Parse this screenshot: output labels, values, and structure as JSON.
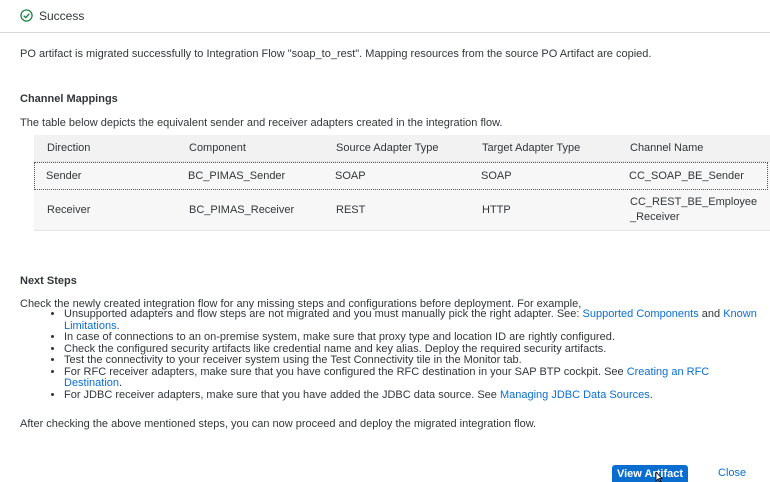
{
  "dialog": {
    "title": "Success",
    "message": "PO artifact is migrated successfully to Integration Flow \"soap_to_rest\". Mapping resources from the source PO Artifact are copied."
  },
  "channel_mappings": {
    "title": "Channel Mappings",
    "description": "The table below depicts the equivalent sender and receiver adapters created in the integration flow.",
    "columns": [
      "Direction",
      "Component",
      "Source Adapter Type",
      "Target Adapter Type",
      "Channel Name"
    ],
    "rows": [
      [
        "Sender",
        "BC_PIMAS_Sender",
        "SOAP",
        "SOAP",
        "CC_SOAP_BE_Sender"
      ],
      [
        "Receiver",
        "BC_PIMAS_Receiver",
        "REST",
        "HTTP",
        "CC_REST_BE_Employee_Receiver"
      ]
    ]
  },
  "next_steps": {
    "title": "Next Steps",
    "intro": "Check the newly created integration flow for any missing steps and configurations before deployment. For example,",
    "items": {
      "i1_text": "Unsupported adapters and flow steps are not migrated and you must manually pick the right adapter. See: ",
      "i1_link1": "Supported Components",
      "i1_and": " and ",
      "i1_link2": "Known Limitations",
      "i1_end": ".",
      "i2": "In case of connections to an on-premise system, make sure that proxy type and location ID are rightly configured.",
      "i3": "Check the configured security artifacts like credential name and key alias. Deploy the required security artifacts.",
      "i4": "Test the connectivity to your receiver system using the Test Connectivity tile in the Monitor tab.",
      "i5_text": "For RFC receiver adapters, make sure that you have configured the RFC destination in your SAP BTP cockpit. See ",
      "i5_link": "Creating an RFC Destination",
      "i5_end": ".",
      "i6_text": "For JDBC receiver adapters, make sure that you have added the JDBC data source. See ",
      "i6_link": "Managing JDBC Data Sources",
      "i6_end": "."
    },
    "after": "After checking the above mentioned steps, you can now proceed and deploy the migrated integration flow."
  },
  "footer": {
    "view_artifact": "View Artifact",
    "close": "Close"
  },
  "colors": {
    "accent": "#0a6ed1",
    "success": "#107e3e"
  }
}
